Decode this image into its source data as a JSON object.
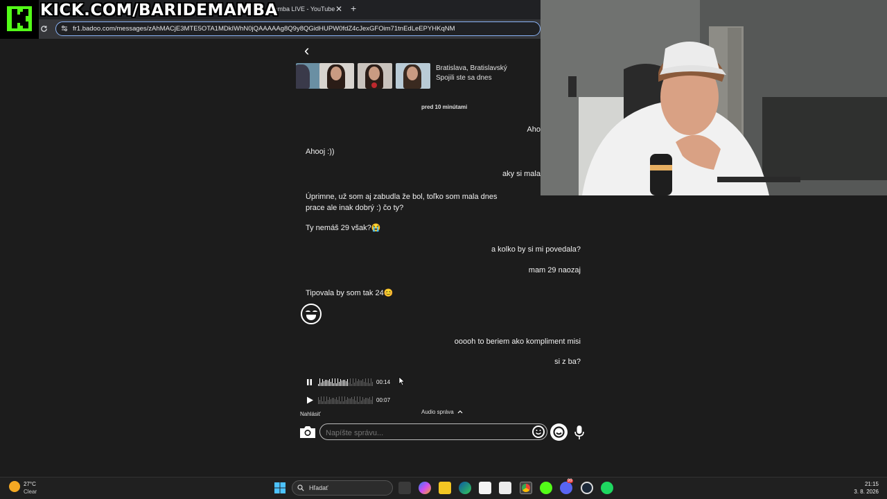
{
  "browser": {
    "tab_title": "mamba LIVE - YouTube",
    "tab_close": "✕",
    "tab_new": "+",
    "url": "fr1.badoo.com/messages/zAhMACjE3MTE5OTA1MDkIWhN0jQAAAAAg8Q9y8QGidHUPW0fdZ4cJexGFOim71tnEdLeEPYHKqNM"
  },
  "overlay": {
    "kick_url": "KICK.COM/BARIDEMAMBA"
  },
  "chat": {
    "back": "‹",
    "location": "Bratislava, Bratislavský",
    "connected": "Spojili ste sa dnes",
    "timestamp": "pred 10 minútami",
    "messages": [
      {
        "side": "right",
        "text": "Aho"
      },
      {
        "side": "left",
        "text": "Ahooj :))"
      },
      {
        "side": "right",
        "text": "aky si mala"
      },
      {
        "side": "left",
        "text": "Úprimne, už som aj zabudla že bol, toľko som mala dnes prace ale inak dobrý :) čo ty?"
      },
      {
        "side": "left",
        "text": "Ty nemáš 29 však?😭"
      },
      {
        "side": "right",
        "text": "a kolko by si mi povedala?"
      },
      {
        "side": "right",
        "text": "mam 29 naozaj"
      },
      {
        "side": "left",
        "text": "Tipovala by som tak 24😊"
      },
      {
        "side": "right",
        "text": "ooooh to beriem ako kompliment misi"
      },
      {
        "side": "right",
        "text": "si z ba?"
      }
    ],
    "audio": [
      {
        "state": "playing",
        "duration": "00:14",
        "progress": 0.55
      },
      {
        "state": "paused",
        "duration": "00:07",
        "progress": 0
      }
    ],
    "report": "Nahlásiť",
    "audio_label": "Audio správa",
    "input_placeholder": "Napíšte správu..."
  },
  "taskbar": {
    "temperature": "27°C",
    "weather": "Clear",
    "search_label": "Hľadať",
    "time": "21:15",
    "date": "3. 8. 2026",
    "icons": [
      "task-view-icon",
      "copilot-icon",
      "file-explorer-icon",
      "edge-icon",
      "store-icon",
      "outlook-icon",
      "chrome-icon",
      "kick-icon",
      "discord-icon",
      "steam-icon",
      "spotify-icon"
    ],
    "discord_badge": "99"
  },
  "colors": {
    "kick_green": "#53fc18",
    "page_bg": "#1c1c1c",
    "taskbar_bg": "#202020"
  }
}
